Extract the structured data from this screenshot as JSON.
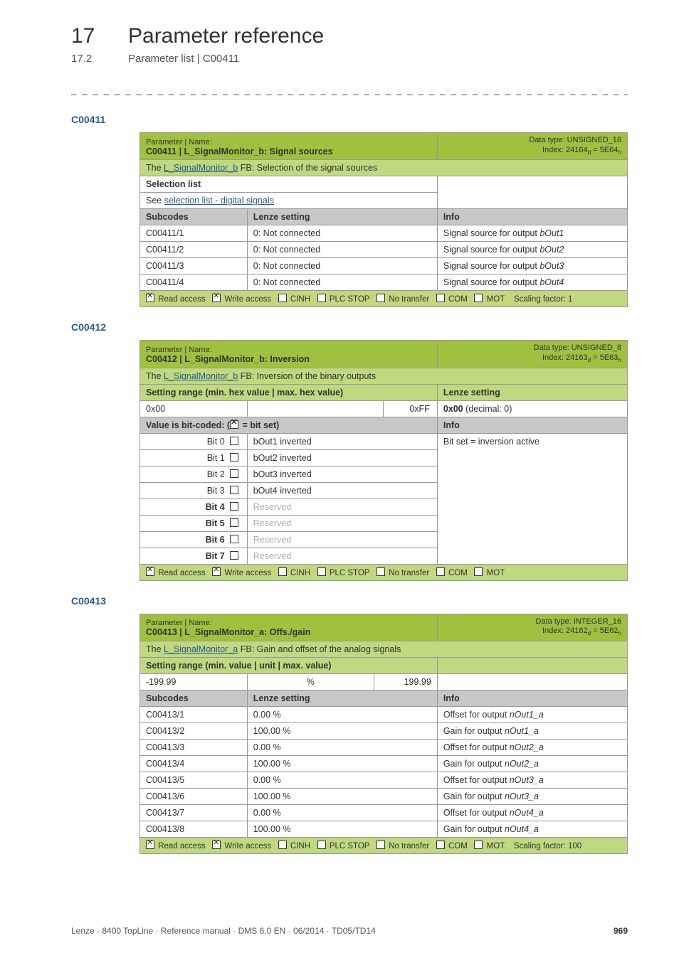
{
  "chapter": {
    "num": "17",
    "title": "Parameter reference"
  },
  "subchapter": {
    "num": "17.2",
    "title": "Parameter list | C00411"
  },
  "dash_line": "_ _ _ _ _ _ _ _ _ _ _ _ _ _ _ _ _ _ _ _ _ _ _ _ _ _ _ _ _ _ _ _ _ _ _ _ _ _ _ _ _ _ _ _ _ _ _ _ _ _ _ _ _ _ _ _ _ _ _ _ _ _ _ _",
  "section1": {
    "code": "C00411",
    "header": {
      "label": "Parameter | Name:",
      "title": "C00411 | L_SignalMonitor_b: Signal sources",
      "dtype_line1": "Data type: UNSIGNED_16",
      "dtype_line2_prefix": "Index: 24164",
      "dtype_line2_suffix": " = 5E64"
    },
    "desc_prefix": "The ",
    "desc_link": "L_SignalMonitor_b",
    "desc_suffix": " FB: Selection of the signal sources",
    "selection_list": "Selection list",
    "see_text": "See ",
    "see_link": "selection list - digital signals",
    "cols": {
      "subcodes": "Subcodes",
      "lenze": "Lenze setting",
      "info": "Info"
    },
    "rows": [
      {
        "sub": "C00411/1",
        "lenze": "0: Not connected",
        "info_prefix": "Signal source for output ",
        "info_em": "bOut1"
      },
      {
        "sub": "C00411/2",
        "lenze": "0: Not connected",
        "info_prefix": "Signal source for output ",
        "info_em": "bOut2"
      },
      {
        "sub": "C00411/3",
        "lenze": "0: Not connected",
        "info_prefix": "Signal source for output ",
        "info_em": "bOut3"
      },
      {
        "sub": "C00411/4",
        "lenze": "0: Not connected",
        "info_prefix": "Signal source for output ",
        "info_em": "bOut4"
      }
    ],
    "foot": {
      "read": "Read access",
      "write": "Write access",
      "cinh": "CINH",
      "plc": "PLC STOP",
      "notr": "No transfer",
      "com": "COM",
      "mot": "MOT",
      "scale": "Scaling factor: 1"
    }
  },
  "section2": {
    "code": "C00412",
    "header": {
      "label": "Parameter | Name:",
      "title": "C00412 | L_SignalMonitor_b: Inversion",
      "dtype_line1": "Data type: UNSIGNED_8",
      "dtype_line2_prefix": "Index: 24163",
      "dtype_line2_suffix": " = 5E63"
    },
    "desc_prefix": "The ",
    "desc_link": "L_SignalMonitor_b",
    "desc_suffix": " FB: Inversion of the binary outputs",
    "setting_range": "Setting range (min. hex value | max. hex value)",
    "lenze_setting": "Lenze setting",
    "min": "0x00",
    "max": "0xFF",
    "default_bold": "0x00",
    "default_rest": "  (decimal: 0)",
    "bit_label_prefix": "Value is bit-coded:  (",
    "bit_label_suffix": " = bit set)",
    "info": "Info",
    "bits": [
      {
        "bit": "Bit 0",
        "label": "bOut1 inverted",
        "reserved": false
      },
      {
        "bit": "Bit 1",
        "label": "bOut2 inverted",
        "reserved": false
      },
      {
        "bit": "Bit 2",
        "label": "bOut3 inverted",
        "reserved": false
      },
      {
        "bit": "Bit 3",
        "label": "bOut4 inverted",
        "reserved": false
      },
      {
        "bit": "Bit 4",
        "label": "Reserved",
        "reserved": true
      },
      {
        "bit": "Bit 5",
        "label": "Reserved",
        "reserved": true
      },
      {
        "bit": "Bit 6",
        "label": "Reserved",
        "reserved": true
      },
      {
        "bit": "Bit 7",
        "label": "Reserved",
        "reserved": true
      }
    ],
    "bitset_info": "Bit set = inversion active",
    "foot": {
      "read": "Read access",
      "write": "Write access",
      "cinh": "CINH",
      "plc": "PLC STOP",
      "notr": "No transfer",
      "com": "COM",
      "mot": "MOT"
    }
  },
  "section3": {
    "code": "C00413",
    "header": {
      "label": "Parameter | Name:",
      "title": "C00413 | L_SignalMonitor_a: Offs./gain",
      "dtype_line1": "Data type: INTEGER_16",
      "dtype_line2_prefix": "Index: 24162",
      "dtype_line2_suffix": " = 5E62"
    },
    "desc_prefix": "The ",
    "desc_link": "L_SignalMonitor_a",
    "desc_suffix": " FB: Gain and offset of the analog signals",
    "setting_range": "Setting range (min. value | unit | max. value)",
    "min": "-199.99",
    "unit": "%",
    "max": "199.99",
    "cols": {
      "subcodes": "Subcodes",
      "lenze": "Lenze setting",
      "info": "Info"
    },
    "rows": [
      {
        "sub": "C00413/1",
        "lenze": "0.00 %",
        "info_prefix": "Offset for output ",
        "info_em": "nOut1_a"
      },
      {
        "sub": "C00413/2",
        "lenze": "100.00 %",
        "info_prefix": "Gain for output ",
        "info_em": "nOut1_a"
      },
      {
        "sub": "C00413/3",
        "lenze": "0.00 %",
        "info_prefix": "Offset for output ",
        "info_em": "nOut2_a"
      },
      {
        "sub": "C00413/4",
        "lenze": "100.00 %",
        "info_prefix": "Gain for output ",
        "info_em": "nOut2_a"
      },
      {
        "sub": "C00413/5",
        "lenze": "0.00 %",
        "info_prefix": "Offset for output ",
        "info_em": "nOut3_a"
      },
      {
        "sub": "C00413/6",
        "lenze": "100.00 %",
        "info_prefix": "Gain for output ",
        "info_em": "nOut3_a"
      },
      {
        "sub": "C00413/7",
        "lenze": "0.00 %",
        "info_prefix": "Offset for output ",
        "info_em": "nOut4_a"
      },
      {
        "sub": "C00413/8",
        "lenze": "100.00 %",
        "info_prefix": "Gain for output ",
        "info_em": "nOut4_a"
      }
    ],
    "foot": {
      "read": "Read access",
      "write": "Write access",
      "cinh": "CINH",
      "plc": "PLC STOP",
      "notr": "No transfer",
      "com": "COM",
      "mot": "MOT",
      "scale": "Scaling factor: 100"
    }
  },
  "footer": {
    "left": "Lenze · 8400 TopLine · Reference manual · DMS 6.0 EN · 06/2014 · TD05/TD14",
    "page": "969"
  }
}
